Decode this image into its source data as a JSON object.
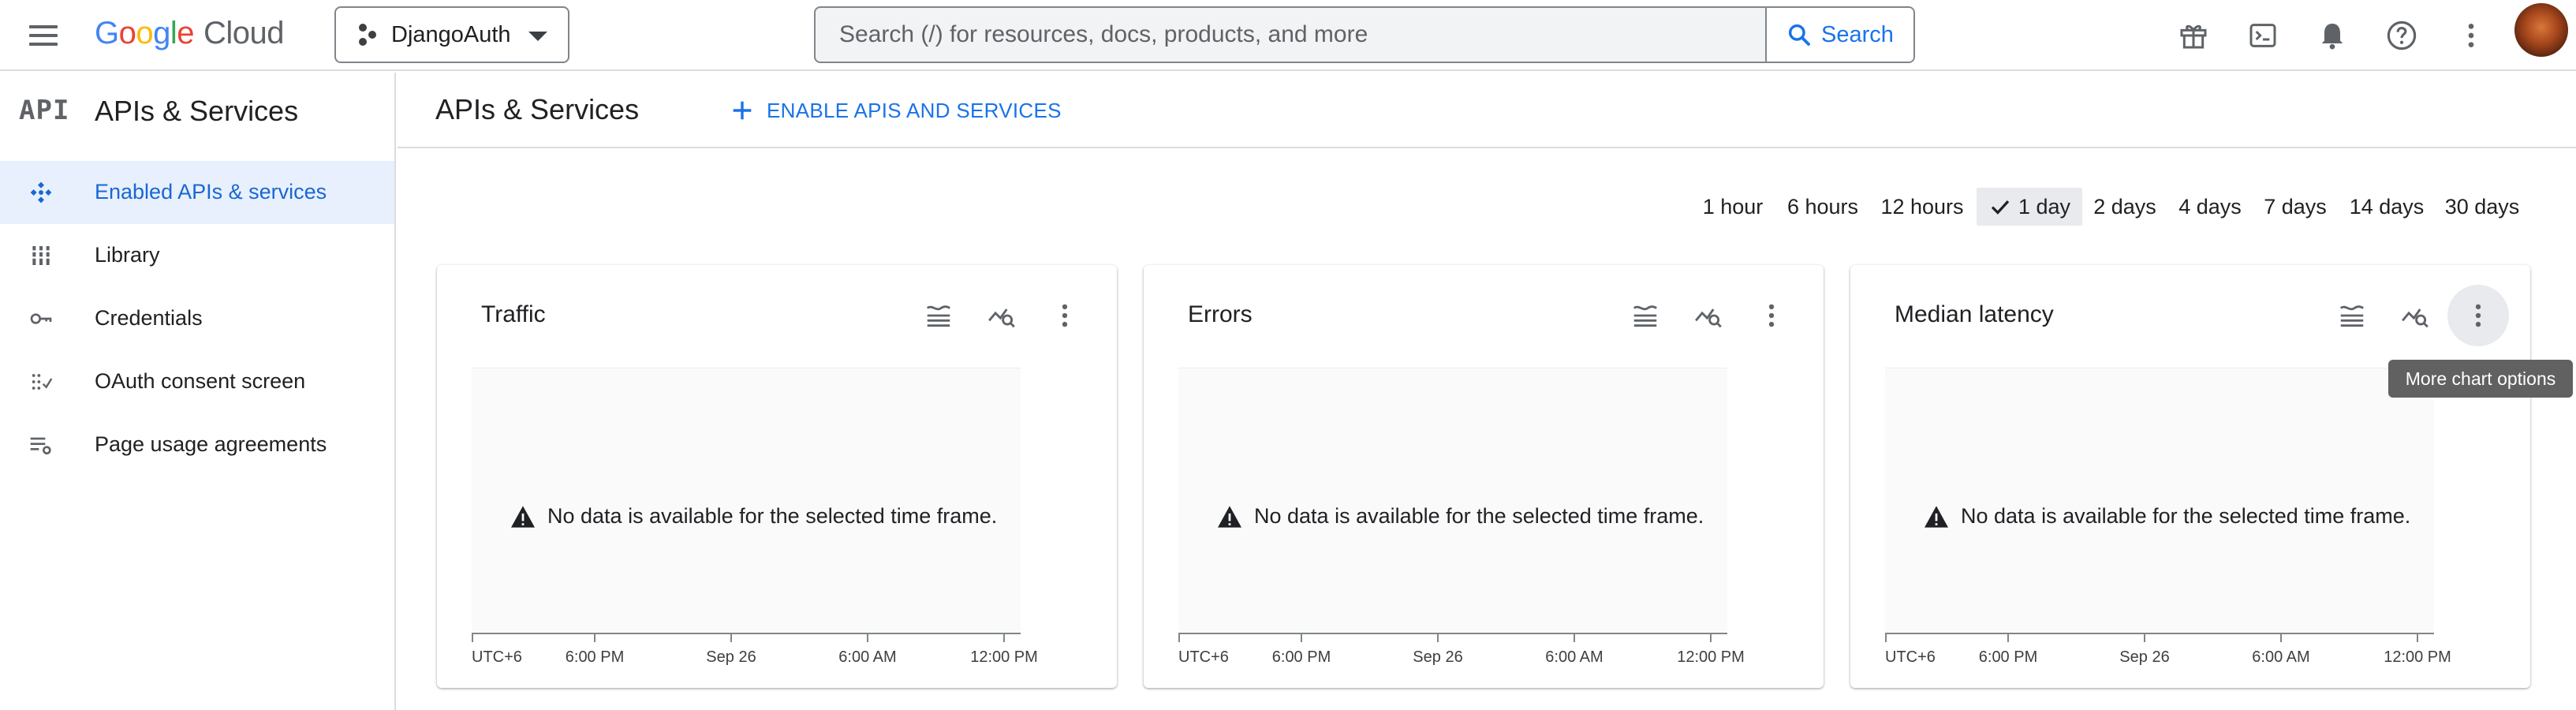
{
  "header": {
    "logo_letters": [
      "G",
      "o",
      "o",
      "g",
      "l",
      "e"
    ],
    "logo_cloud": "Cloud",
    "project": "DjangoAuth",
    "search_placeholder": "Search (/) for resources, docs, products, and more",
    "search_button": "Search",
    "icons": [
      "gift-icon",
      "cloud-shell-icon",
      "notifications-icon",
      "help-icon",
      "more-vert-icon",
      "account-avatar"
    ]
  },
  "sidebar": {
    "logo": "API",
    "title": "APIs & Services",
    "items": [
      {
        "label": "Enabled APIs & services",
        "icon": "enabled-apis-icon",
        "active": true
      },
      {
        "label": "Library",
        "icon": "library-icon",
        "active": false
      },
      {
        "label": "Credentials",
        "icon": "key-icon",
        "active": false
      },
      {
        "label": "OAuth consent screen",
        "icon": "oauth-consent-icon",
        "active": false
      },
      {
        "label": "Page usage agreements",
        "icon": "page-settings-icon",
        "active": false
      }
    ]
  },
  "main": {
    "title": "APIs & Services",
    "enable_button": "ENABLE APIS AND SERVICES",
    "time_ranges": [
      "1 hour",
      "6 hours",
      "12 hours",
      "1 day",
      "2 days",
      "4 days",
      "7 days",
      "14 days",
      "30 days"
    ],
    "selected_range": "1 day",
    "cards": [
      {
        "title": "Traffic",
        "no_data": "No data is available for the selected time frame.",
        "x_ticks": [
          "UTC+6",
          "6:00 PM",
          "Sep 26",
          "6:00 AM",
          "12:00 PM"
        ]
      },
      {
        "title": "Errors",
        "no_data": "No data is available for the selected time frame.",
        "x_ticks": [
          "UTC+6",
          "6:00 PM",
          "Sep 26",
          "6:00 AM",
          "12:00 PM"
        ]
      },
      {
        "title": "Median latency",
        "no_data": "No data is available for the selected time frame.",
        "x_ticks": [
          "UTC+6",
          "6:00 PM",
          "Sep 26",
          "6:00 AM",
          "12:00 PM"
        ]
      }
    ],
    "tooltip": "More chart options"
  },
  "colors": {
    "accent": "#1a73e8",
    "active_nav_bg": "#e8f0fe",
    "border": "#dadce0",
    "icon_gray": "#5f6368"
  }
}
